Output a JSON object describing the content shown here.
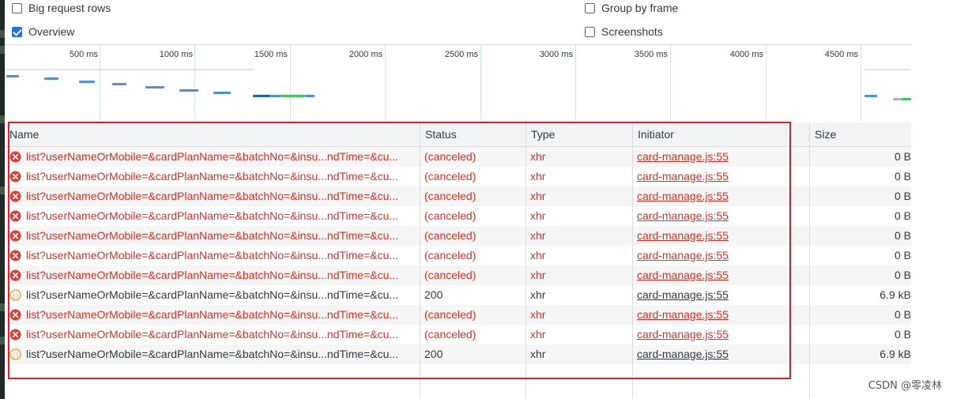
{
  "options": {
    "big_request_rows": {
      "label": "Big request rows",
      "checked": false
    },
    "overview": {
      "label": "Overview",
      "checked": true
    },
    "group_by_frame": {
      "label": "Group by frame",
      "checked": false
    },
    "screenshots": {
      "label": "Screenshots",
      "checked": false
    }
  },
  "timeline": {
    "ticks": [
      "500 ms",
      "1000 ms",
      "1500 ms",
      "2000 ms",
      "2500 ms",
      "3000 ms",
      "3500 ms",
      "4000 ms",
      "4500 ms"
    ]
  },
  "table": {
    "columns": {
      "name": "Name",
      "status": "Status",
      "type": "Type",
      "initiator": "Initiator",
      "size": "Size"
    },
    "rows": [
      {
        "name": "list?userNameOrMobile=&cardPlanName=&batchNo=&insu...ndTime=&cu...",
        "status": "(canceled)",
        "type": "xhr",
        "initiator": "card-manage.js:55",
        "size": "0 B",
        "state": "error"
      },
      {
        "name": "list?userNameOrMobile=&cardPlanName=&batchNo=&insu...ndTime=&cu...",
        "status": "(canceled)",
        "type": "xhr",
        "initiator": "card-manage.js:55",
        "size": "0 B",
        "state": "error"
      },
      {
        "name": "list?userNameOrMobile=&cardPlanName=&batchNo=&insu...ndTime=&cu...",
        "status": "(canceled)",
        "type": "xhr",
        "initiator": "card-manage.js:55",
        "size": "0 B",
        "state": "error"
      },
      {
        "name": "list?userNameOrMobile=&cardPlanName=&batchNo=&insu...ndTime=&cu...",
        "status": "(canceled)",
        "type": "xhr",
        "initiator": "card-manage.js:55",
        "size": "0 B",
        "state": "error"
      },
      {
        "name": "list?userNameOrMobile=&cardPlanName=&batchNo=&insu...ndTime=&cu...",
        "status": "(canceled)",
        "type": "xhr",
        "initiator": "card-manage.js:55",
        "size": "0 B",
        "state": "error"
      },
      {
        "name": "list?userNameOrMobile=&cardPlanName=&batchNo=&insu...ndTime=&cu...",
        "status": "(canceled)",
        "type": "xhr",
        "initiator": "card-manage.js:55",
        "size": "0 B",
        "state": "error"
      },
      {
        "name": "list?userNameOrMobile=&cardPlanName=&batchNo=&insu...ndTime=&cu...",
        "status": "(canceled)",
        "type": "xhr",
        "initiator": "card-manage.js:55",
        "size": "0 B",
        "state": "error"
      },
      {
        "name": "list?userNameOrMobile=&cardPlanName=&batchNo=&insu...ndTime=&cu...",
        "status": "200",
        "type": "xhr",
        "initiator": "card-manage.js:55",
        "size": "6.9 kB",
        "state": "ok"
      },
      {
        "name": "list?userNameOrMobile=&cardPlanName=&batchNo=&insu...ndTime=&cu...",
        "status": "(canceled)",
        "type": "xhr",
        "initiator": "card-manage.js:55",
        "size": "0 B",
        "state": "error"
      },
      {
        "name": "list?userNameOrMobile=&cardPlanName=&batchNo=&insu...ndTime=&cu...",
        "status": "(canceled)",
        "type": "xhr",
        "initiator": "card-manage.js:55",
        "size": "0 B",
        "state": "error"
      },
      {
        "name": "list?userNameOrMobile=&cardPlanName=&batchNo=&insu...ndTime=&cu...",
        "status": "200",
        "type": "xhr",
        "initiator": "card-manage.js:55",
        "size": "6.9 kB",
        "state": "ok"
      }
    ]
  },
  "colors": {
    "error": "#d93025",
    "ok_icon": "#e8a93a",
    "highlight": "#e01e2b",
    "check": "#1a73e8"
  },
  "icons": {
    "error": "error-circle-icon",
    "ok": "xhr-fetch-icon"
  },
  "watermark": "CSDN @零凌林"
}
